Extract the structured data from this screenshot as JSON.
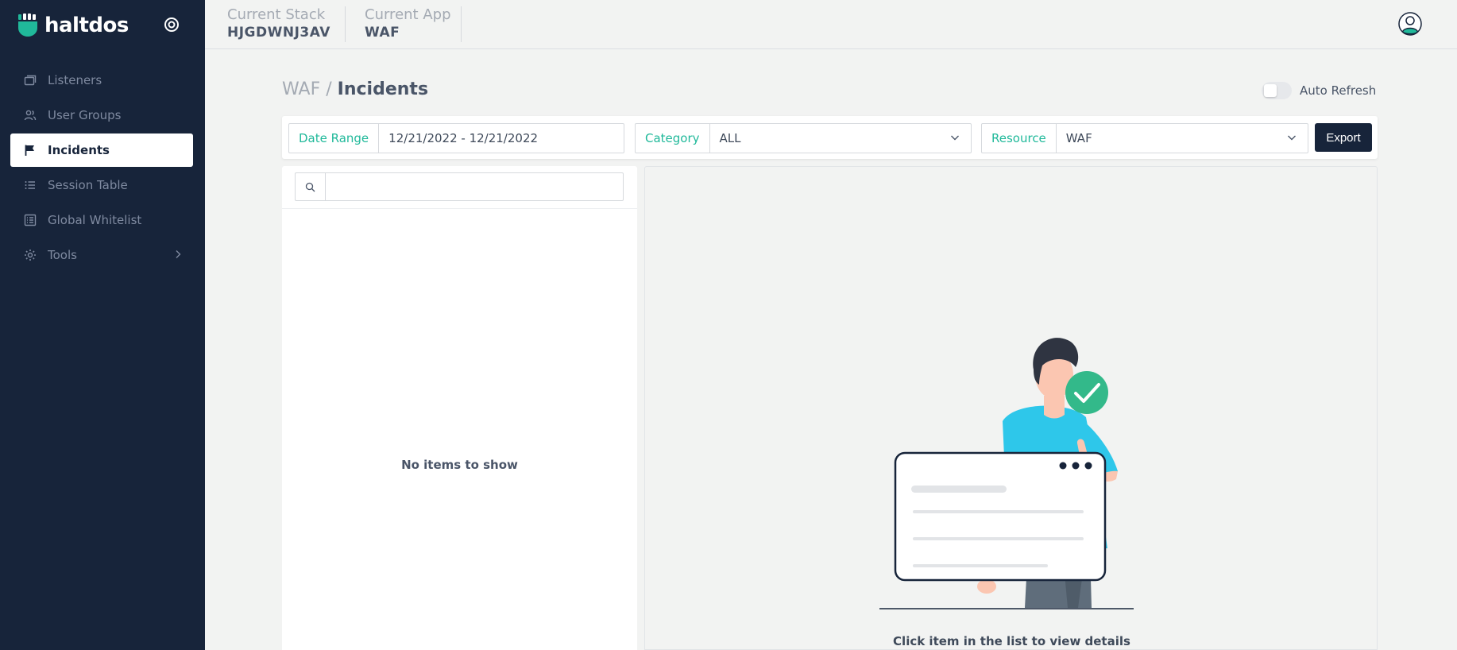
{
  "brand": {
    "name": "haltdos"
  },
  "sidebar": {
    "items": [
      {
        "label": "Listeners",
        "icon": "listeners-icon",
        "active": false
      },
      {
        "label": "User Groups",
        "icon": "users-icon",
        "active": false
      },
      {
        "label": "Incidents",
        "icon": "flag-icon",
        "active": true
      },
      {
        "label": "Session Table",
        "icon": "list-icon",
        "active": false
      },
      {
        "label": "Global Whitelist",
        "icon": "whitelist-icon",
        "active": false
      },
      {
        "label": "Tools",
        "icon": "gear-icon",
        "active": false
      }
    ]
  },
  "header": {
    "stack_label": "Current Stack",
    "stack_value": "HJGDWNJ3AV",
    "app_label": "Current App",
    "app_value": "WAF"
  },
  "page": {
    "breadcrumb": "WAF /",
    "title": "Incidents",
    "auto_refresh_label": "Auto Refresh",
    "auto_refresh_on": false
  },
  "filters": {
    "date_label": "Date Range",
    "date_value": "12/21/2022 - 12/21/2022",
    "category_label": "Category",
    "category_value": "ALL",
    "resource_label": "Resource",
    "resource_value": "WAF",
    "export_label": "Export"
  },
  "list": {
    "search_placeholder": "",
    "empty_text": "No items to show"
  },
  "details": {
    "hint": "Click item in the list to view details"
  },
  "colors": {
    "sidebar_bg": "#17243a",
    "accent": "#20b99a",
    "shirt": "#2ec7ea",
    "button_dark": "#17243a"
  }
}
